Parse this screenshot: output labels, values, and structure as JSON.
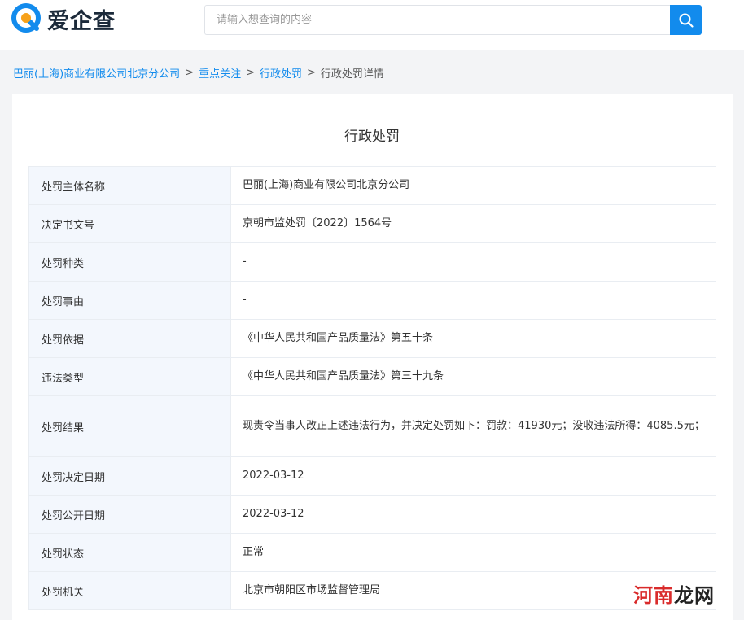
{
  "header": {
    "logo_text": "爱企查",
    "search_placeholder": "请输入想查询的内容"
  },
  "breadcrumb": {
    "items": [
      "巴丽(上海)商业有限公司北京分公司",
      "重点关注",
      "行政处罚"
    ],
    "separator": ">",
    "current": "行政处罚详情"
  },
  "card": {
    "title": "行政处罚"
  },
  "rows": [
    {
      "label": "处罚主体名称",
      "value": "巴丽(上海)商业有限公司北京分公司"
    },
    {
      "label": "决定书文号",
      "value": "京朝市监处罚〔2022〕1564号"
    },
    {
      "label": "处罚种类",
      "value": "-"
    },
    {
      "label": "处罚事由",
      "value": "-"
    },
    {
      "label": "处罚依据",
      "value": "《中华人民共和国产品质量法》第五十条"
    },
    {
      "label": "违法类型",
      "value": "《中华人民共和国产品质量法》第三十九条"
    },
    {
      "label": "处罚结果",
      "value": "现责令当事人改正上述违法行为，并决定处罚如下：罚款：41930元；没收违法所得：4085.5元；"
    },
    {
      "label": "处罚决定日期",
      "value": "2022-03-12"
    },
    {
      "label": "处罚公开日期",
      "value": "2022-03-12"
    },
    {
      "label": "处罚状态",
      "value": "正常"
    },
    {
      "label": "处罚机关",
      "value": "北京市朝阳区市场监督管理局"
    }
  ],
  "watermark": {
    "red": "河南",
    "black": "龙网"
  },
  "colors": {
    "accent": "#128bed",
    "logo_orange": "#f7a11a",
    "label_bg": "#f3f7fd"
  }
}
